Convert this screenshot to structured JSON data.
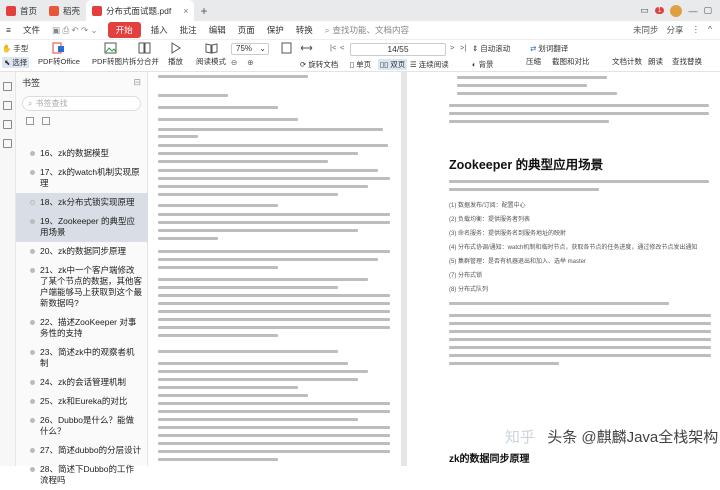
{
  "tabs": [
    {
      "label": "首页",
      "icon": "home-icon",
      "color": "#e33f3f",
      "active": false
    },
    {
      "label": "稻壳",
      "icon": "docer-icon",
      "color": "#e8553b",
      "active": false
    },
    {
      "label": "分布式面试题.pdf",
      "icon": "pdf-icon",
      "color": "#e33f3f",
      "active": true
    }
  ],
  "titlebar_right": {
    "badge": "1"
  },
  "menu": {
    "file_label": "文件",
    "items": [
      "开始",
      "插入",
      "批注",
      "编辑",
      "页面",
      "保护",
      "转换"
    ],
    "active_item": "开始",
    "search_label": "查找功能、文档内容",
    "right": [
      "未同步",
      "分享"
    ]
  },
  "toolbar": {
    "hand_label": "手型",
    "select_label": "选择",
    "pdf2office_label": "PDF转Office",
    "pdf2img_label": "PDF转图片",
    "split_label": "拆分合并",
    "play_label": "播放",
    "read_mode_label": "阅读模式",
    "zoom_value": "75%",
    "page_value": "14/55",
    "rotate_label": "旋转文档",
    "single_label": "单页",
    "double_label": "双页",
    "continuous_label": "连续阅读",
    "translate_label": "划词翻译",
    "compress_label": "压缩",
    "screen_label": "截图和对比",
    "word_count_label": "文档计数",
    "read_label": "朗读",
    "find_replace_label": "查找替换",
    "auto_scroll_label": "自动滚动",
    "bg_label": "背景"
  },
  "panel": {
    "title": "书签",
    "search_placeholder": "书签查找",
    "bookmarks": [
      {
        "text": "16、zk的数据模型",
        "selected": false
      },
      {
        "text": "17、zk的watch机制实现原理",
        "selected": false
      },
      {
        "text": "18、zk分布式锁实现原理",
        "selected": true
      },
      {
        "text": "19、Zookeeper 的典型应用场景",
        "selected": true
      },
      {
        "text": "20、zk的数据同步原理",
        "selected": false
      },
      {
        "text": "21、zk中一个客户端修改了某个节点的数据，其他客户端能够马上获取到这个最新数据吗?",
        "selected": false
      },
      {
        "text": "22、描述ZooKeeper 对事务性的支持",
        "selected": false
      },
      {
        "text": "23、简述zk中的观察者机制",
        "selected": false
      },
      {
        "text": "24、zk的会话管理机制",
        "selected": false
      },
      {
        "text": "25、zk和Eureka的对比",
        "selected": false
      },
      {
        "text": "26、Dubbo是什么？能做什么？",
        "selected": false
      },
      {
        "text": "27、简述dubbo的分层设计",
        "selected": false
      },
      {
        "text": "28、简述下Dubbo的工作流程吗",
        "selected": false
      }
    ]
  },
  "doc": {
    "heading_right": "Zookeeper 的典型应用场景",
    "list_items": [
      "(1)  数据发布/订阅：配置中心",
      "(2)  负载均衡：提供服务者列表",
      "(3)  命名服务：提供服务名到服务地址的映射",
      "(4)  分布式协调/通知：watch机制和临时节点，获取各节点的任务进度，通过修改节点发出通知",
      "(5)  集群管理：是否有机器退出和加入、选举 master",
      "(7)  分布式锁",
      "(8)  分布式队列"
    ],
    "heading_bottom": "zk的数据同步原理"
  },
  "watermark": {
    "left": "知乎",
    "right": "头条 @麒麟Java全栈架构"
  },
  "colors": {
    "accent": "#e33f3f",
    "selected_bg": "#d8dde6"
  }
}
